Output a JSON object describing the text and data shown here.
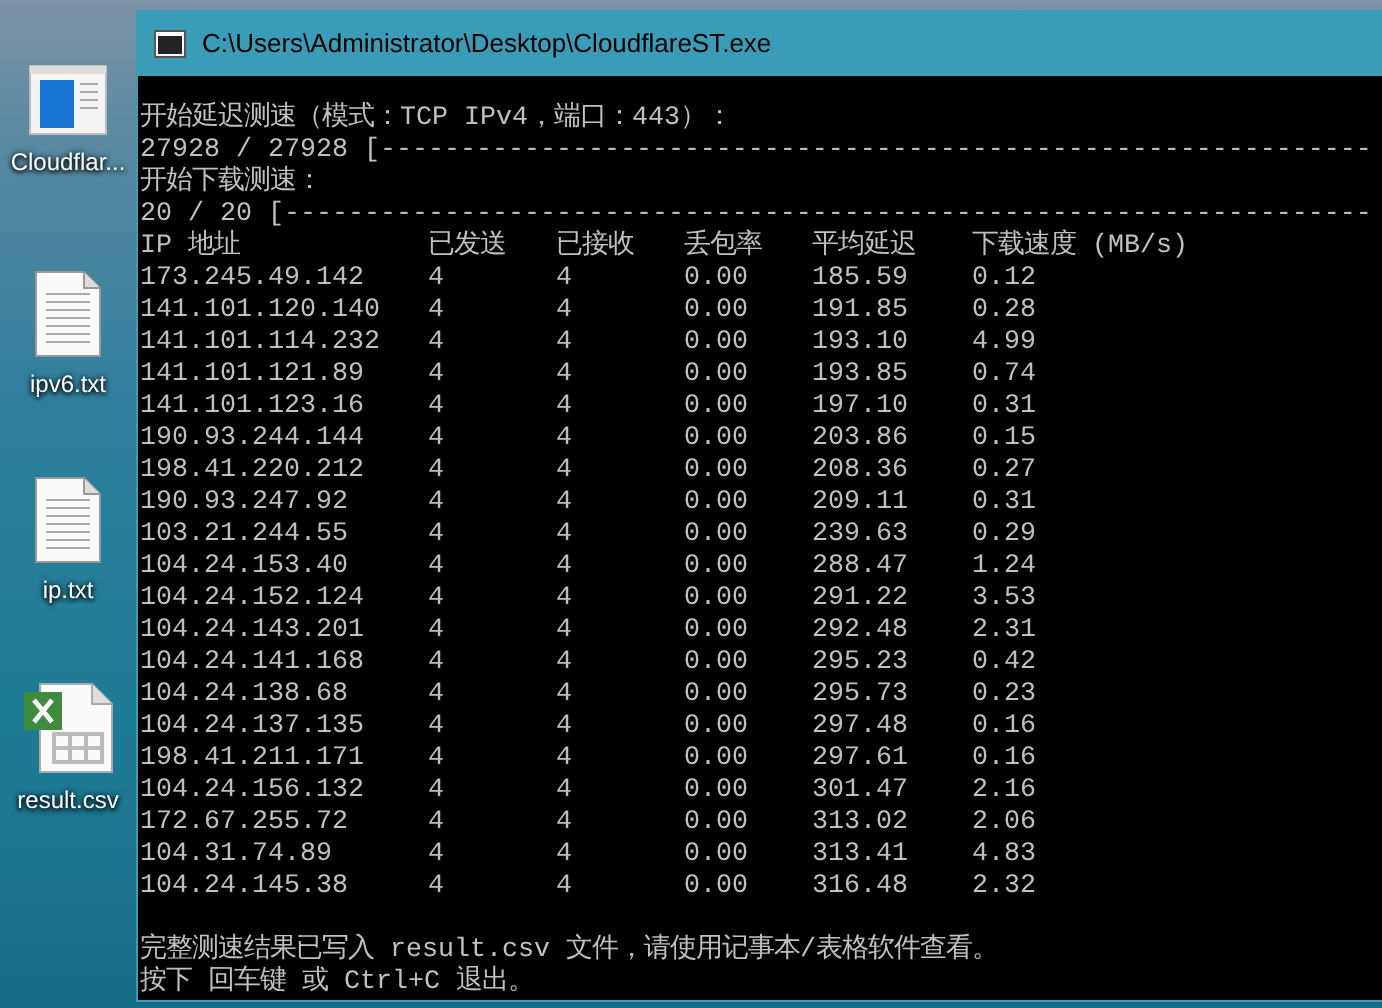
{
  "desktop_icons": [
    {
      "kind": "app",
      "label": "Cloudflar..."
    },
    {
      "kind": "text",
      "label": "ipv6.txt"
    },
    {
      "kind": "text",
      "label": "ip.txt"
    },
    {
      "kind": "sheet",
      "label": "result.csv"
    }
  ],
  "window": {
    "title": "C:\\Users\\Administrator\\Desktop\\CloudflareST.exe"
  },
  "console": {
    "lines_before": [
      "开始延迟测速（模式：TCP IPv4，端口：443）：",
      "27928 / 27928 [--------------------------------------------------------------",
      "开始下载测速：",
      "20 / 20 [--------------------------------------------------------------------"
    ],
    "table": {
      "columns": [
        "IP 地址",
        "已发送",
        "已接收",
        "丢包率",
        "平均延迟",
        "下载速度 (MB/s)"
      ],
      "rows": [
        [
          "173.245.49.142",
          "4",
          "4",
          "0.00",
          "185.59",
          "0.12"
        ],
        [
          "141.101.120.140",
          "4",
          "4",
          "0.00",
          "191.85",
          "0.28"
        ],
        [
          "141.101.114.232",
          "4",
          "4",
          "0.00",
          "193.10",
          "4.99"
        ],
        [
          "141.101.121.89",
          "4",
          "4",
          "0.00",
          "193.85",
          "0.74"
        ],
        [
          "141.101.123.16",
          "4",
          "4",
          "0.00",
          "197.10",
          "0.31"
        ],
        [
          "190.93.244.144",
          "4",
          "4",
          "0.00",
          "203.86",
          "0.15"
        ],
        [
          "198.41.220.212",
          "4",
          "4",
          "0.00",
          "208.36",
          "0.27"
        ],
        [
          "190.93.247.92",
          "4",
          "4",
          "0.00",
          "209.11",
          "0.31"
        ],
        [
          "103.21.244.55",
          "4",
          "4",
          "0.00",
          "239.63",
          "0.29"
        ],
        [
          "104.24.153.40",
          "4",
          "4",
          "0.00",
          "288.47",
          "1.24"
        ],
        [
          "104.24.152.124",
          "4",
          "4",
          "0.00",
          "291.22",
          "3.53"
        ],
        [
          "104.24.143.201",
          "4",
          "4",
          "0.00",
          "292.48",
          "2.31"
        ],
        [
          "104.24.141.168",
          "4",
          "4",
          "0.00",
          "295.23",
          "0.42"
        ],
        [
          "104.24.138.68",
          "4",
          "4",
          "0.00",
          "295.73",
          "0.23"
        ],
        [
          "104.24.137.135",
          "4",
          "4",
          "0.00",
          "297.48",
          "0.16"
        ],
        [
          "198.41.211.171",
          "4",
          "4",
          "0.00",
          "297.61",
          "0.16"
        ],
        [
          "104.24.156.132",
          "4",
          "4",
          "0.00",
          "301.47",
          "2.16"
        ],
        [
          "172.67.255.72",
          "4",
          "4",
          "0.00",
          "313.02",
          "2.06"
        ],
        [
          "104.31.74.89",
          "4",
          "4",
          "0.00",
          "313.41",
          "4.83"
        ],
        [
          "104.24.145.38",
          "4",
          "4",
          "0.00",
          "316.48",
          "2.32"
        ]
      ]
    },
    "lines_after": [
      "完整测速结果已写入 result.csv 文件，请使用记事本/表格软件查看。",
      "按下 回车键 或 Ctrl+C 退出。"
    ]
  }
}
